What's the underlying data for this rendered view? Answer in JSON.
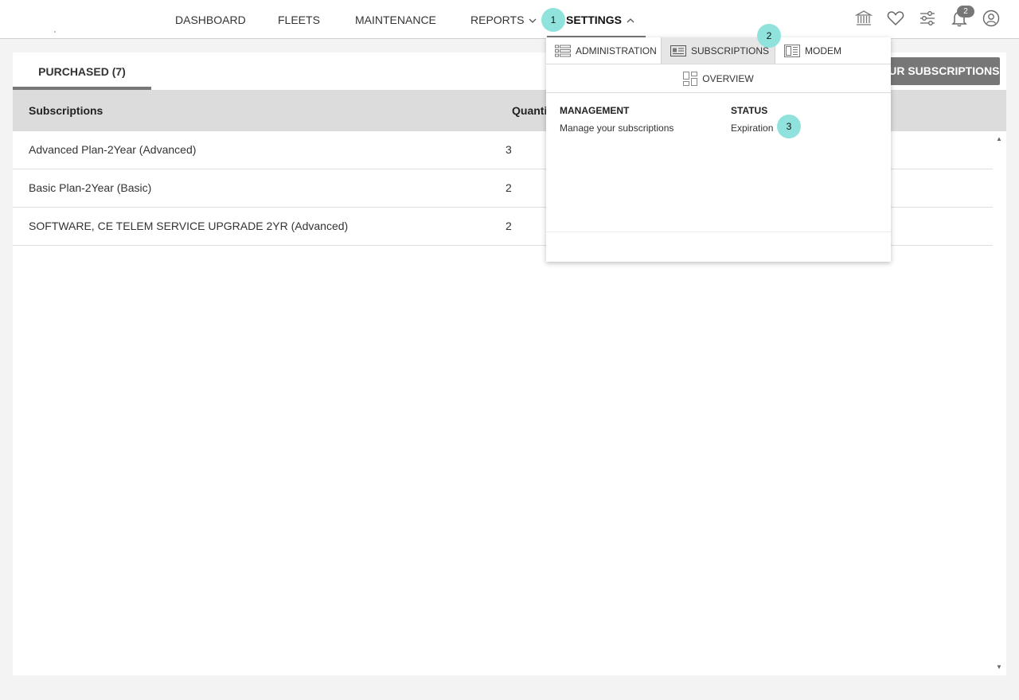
{
  "nav": {
    "items": [
      {
        "label": "DASHBOARD"
      },
      {
        "label": "FLEETS"
      },
      {
        "label": "MAINTENANCE"
      },
      {
        "label": "REPORTS"
      },
      {
        "label": "SETTINGS"
      }
    ],
    "notification_count": "2"
  },
  "icons": {
    "org": "bank-icon",
    "favorites": "heart-icon",
    "filters": "sliders-icon",
    "notifications": "bell-icon",
    "profile": "user-icon"
  },
  "tabs": {
    "purchased": "PURCHASED (7)",
    "your_subscriptions_button": "YOUR SUBSCRIPTIONS"
  },
  "table": {
    "headers": [
      "Subscriptions",
      "Quantity"
    ],
    "rows": [
      {
        "name": "Advanced Plan-2Year (Advanced)",
        "quantity": "3"
      },
      {
        "name": "Basic Plan-2Year (Basic)",
        "quantity": "2"
      },
      {
        "name": "SOFTWARE, CE TELEM SERVICE UPGRADE 2YR (Advanced)",
        "quantity": "2"
      }
    ]
  },
  "dropdown": {
    "tabs": [
      {
        "label": "ADMINISTRATION"
      },
      {
        "label": "SUBSCRIPTIONS"
      },
      {
        "label": "MODEM"
      }
    ],
    "overview": "OVERVIEW",
    "sections": [
      {
        "title": "MANAGEMENT",
        "link": "Manage your subscriptions"
      },
      {
        "title": "STATUS",
        "link": "Expiration"
      }
    ]
  },
  "markers": [
    "1",
    "2",
    "3"
  ],
  "colors": {
    "accent_gray": "#777777",
    "marker_teal": "#8fe3dc",
    "header_gray": "#dcdcdc"
  }
}
